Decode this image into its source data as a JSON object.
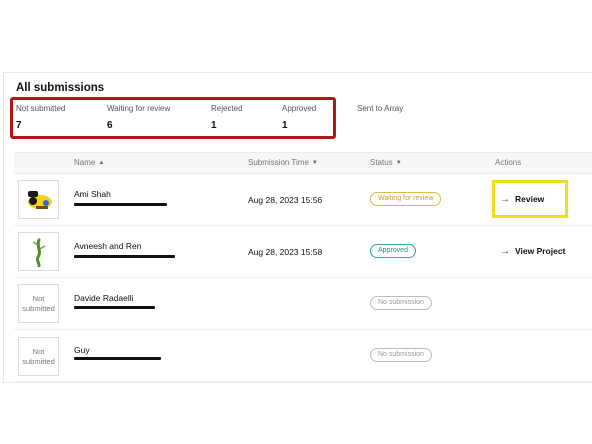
{
  "page": {
    "title": "All submissions"
  },
  "stats": [
    {
      "label": "Not submitted",
      "value": "7"
    },
    {
      "label": "Waiting for review",
      "value": "6"
    },
    {
      "label": "Rejected",
      "value": "1"
    },
    {
      "label": "Approved",
      "value": "1"
    },
    {
      "label": "Sent to Array",
      "value": ""
    }
  ],
  "table": {
    "columns": [
      "Name",
      "Submission Time",
      "Status",
      "Actions"
    ],
    "rows": [
      {
        "thumb": "cartoon-character-thumbnail",
        "name": "Ami Shah",
        "time": "Aug 28, 2023 15:56",
        "status": "Waiting for review",
        "status_kind": "waiting",
        "action": "Review"
      },
      {
        "thumb": "green-figure-thumbnail",
        "name": "Avneesh and Ren",
        "time": "Aug 28, 2023 15:58",
        "status": "Approved",
        "status_kind": "approved",
        "action": "View Project"
      },
      {
        "thumb": "Not submitted",
        "name": "Davide Radaelli",
        "time": "",
        "status": "No submission",
        "status_kind": "none",
        "action": ""
      },
      {
        "thumb": "Not submitted",
        "name": "Guy",
        "time": "",
        "status": "No submission",
        "status_kind": "none",
        "action": ""
      }
    ]
  },
  "colors": {
    "highlight_red": "#b31616",
    "highlight_yellow": "#f0dd24",
    "waiting": "#d19b24",
    "approved": "#1f8f82"
  }
}
